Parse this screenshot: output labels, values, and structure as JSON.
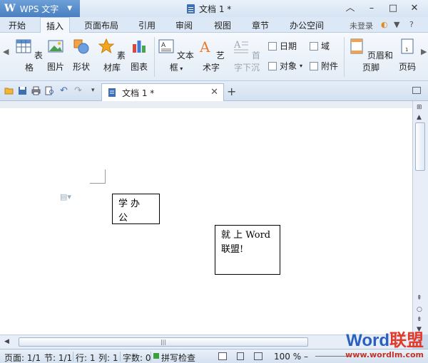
{
  "app": {
    "name": "WPS 文字",
    "logo": "W"
  },
  "window": {
    "title": "文档 1 *",
    "controls": [
      "minimize-icon",
      "restore-icon",
      "close-icon"
    ]
  },
  "menu": {
    "tabs": [
      "开始",
      "插入",
      "页面布局",
      "引用",
      "审阅",
      "视图",
      "章节",
      "办公空间"
    ],
    "active": "插入",
    "login": "未登录",
    "help": "?"
  },
  "ribbon": {
    "table": "表格",
    "picture": "图片",
    "shape": "形状",
    "material": "素材库",
    "chart": "图表",
    "textbox": "文本框",
    "wordart": "艺术字",
    "dropcap": "首字下沉",
    "date": "日期",
    "field": "域",
    "object": "对象",
    "attachment": "附件",
    "header_footer": "页眉和页脚",
    "page_number": "页码"
  },
  "doc_tab": {
    "label": "文档 1 *"
  },
  "content": {
    "box1": "学办公",
    "box2_line1": "就 上 Word",
    "box2_line2": "联盟!"
  },
  "status": {
    "page": "页面: 1/1",
    "section": "节: 1/1",
    "line": "行: 1",
    "column": "列: 1",
    "wordcount": "字数: 0",
    "spellcheck": "拼写检查",
    "zoom": "100 %"
  },
  "watermark": {
    "brand_a": "Word",
    "brand_b": "联盟",
    "url": "www.wordlm.com"
  },
  "colors": {
    "accent": "#4a7fc0",
    "ribbon_bg": "#eef4fb",
    "status_bg": "#dbe6f3"
  }
}
